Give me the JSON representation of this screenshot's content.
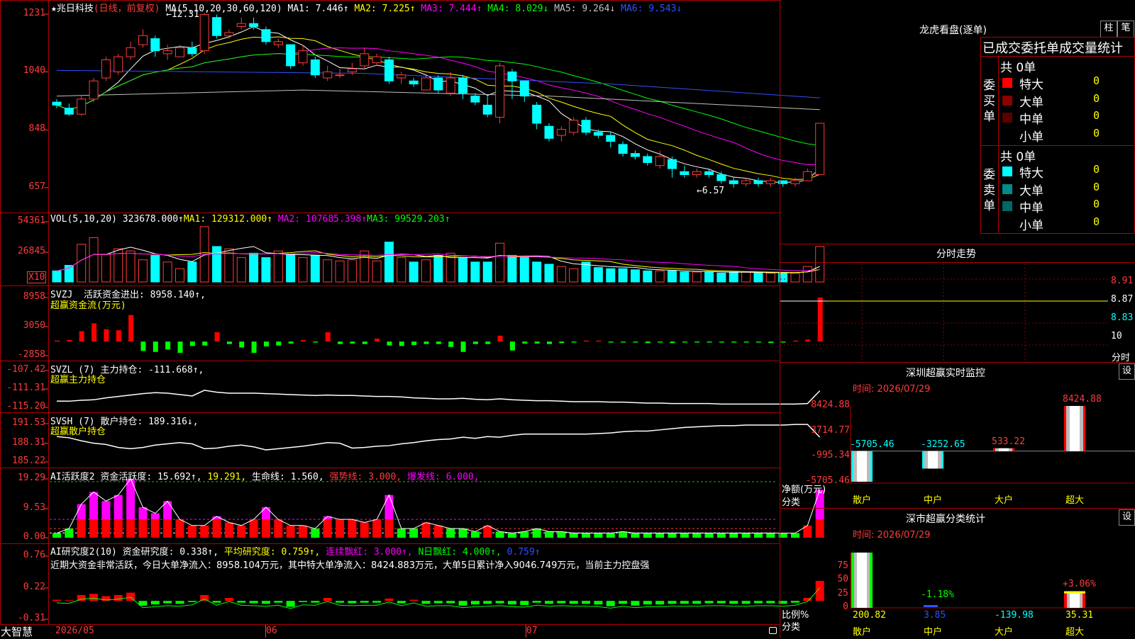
{
  "app": {
    "brand": "大智慧"
  },
  "header": {
    "star": "★",
    "stock": "兆日科技",
    "period": "(日线，前复权)",
    "ma_label": "MA(5,10,20,30,60,120)",
    "ma": [
      {
        "name": "MA1:",
        "value": "7.446↑",
        "color": "#ffffff"
      },
      {
        "name": "MA2:",
        "value": "7.225↑",
        "color": "#ffff00"
      },
      {
        "name": "MA3:",
        "value": "7.444↑",
        "color": "#ff00ff"
      },
      {
        "name": "MA4:",
        "value": "8.029↓",
        "color": "#00ff00"
      },
      {
        "name": "MA5:",
        "value": "9.264↓",
        "color": "#c0c0c0"
      },
      {
        "name": "MA6:",
        "value": "9.543↓",
        "color": "#3050ff"
      }
    ]
  },
  "price_chart": {
    "y_labels": [
      "1231",
      "1040",
      "848",
      "657"
    ],
    "high_marker": "←12.31",
    "low_marker": "←6.57",
    "candles": [
      [
        9.4,
        9.3,
        9.5,
        9.2
      ],
      [
        9.2,
        9.0,
        9.35,
        8.95
      ],
      [
        9.0,
        9.5,
        9.6,
        8.95
      ],
      [
        9.5,
        10.1,
        10.2,
        9.4
      ],
      [
        10.2,
        10.8,
        10.9,
        10.1
      ],
      [
        10.4,
        10.9,
        11.0,
        10.3
      ],
      [
        10.9,
        11.2,
        11.4,
        10.8
      ],
      [
        11.3,
        11.6,
        11.8,
        11.2
      ],
      [
        11.5,
        11.1,
        11.6,
        10.9
      ],
      [
        11.0,
        11.1,
        11.3,
        10.8
      ],
      [
        10.9,
        11.2,
        11.3,
        10.9
      ],
      [
        11.2,
        11.0,
        11.4,
        10.9
      ],
      [
        11.1,
        12.3,
        12.35,
        11.0
      ],
      [
        12.2,
        11.6,
        12.3,
        11.5
      ],
      [
        11.6,
        11.7,
        11.8,
        11.5
      ],
      [
        11.9,
        12.0,
        12.2,
        11.8
      ],
      [
        12.0,
        11.9,
        12.2,
        11.8
      ],
      [
        11.8,
        11.4,
        11.9,
        11.3
      ],
      [
        11.3,
        11.4,
        11.5,
        11.2
      ],
      [
        11.3,
        10.6,
        11.3,
        10.5
      ],
      [
        10.7,
        11.1,
        11.3,
        10.6
      ],
      [
        10.8,
        10.3,
        10.9,
        10.2
      ],
      [
        10.2,
        10.4,
        10.6,
        10.1
      ],
      [
        10.3,
        10.3,
        10.5,
        10.2
      ],
      [
        10.4,
        10.5,
        10.7,
        10.3
      ],
      [
        10.6,
        11.0,
        11.2,
        10.5
      ],
      [
        10.7,
        10.9,
        11.0,
        10.6
      ],
      [
        10.8,
        10.1,
        10.9,
        10.0
      ],
      [
        10.2,
        10.3,
        10.4,
        10.0
      ],
      [
        10.1,
        10.0,
        10.2,
        9.9
      ],
      [
        9.8,
        10.2,
        10.3,
        9.8
      ],
      [
        10.2,
        9.8,
        10.3,
        9.7
      ],
      [
        9.7,
        10.2,
        10.4,
        9.6
      ],
      [
        10.2,
        9.7,
        10.3,
        9.5
      ],
      [
        9.6,
        9.4,
        9.7,
        9.3
      ],
      [
        9.3,
        9.0,
        9.6,
        8.9
      ],
      [
        8.9,
        10.6,
        10.7,
        8.7
      ],
      [
        10.4,
        10.1,
        10.5,
        9.5
      ],
      [
        10.1,
        9.6,
        10.1,
        9.4
      ],
      [
        9.3,
        8.7,
        9.4,
        8.5
      ],
      [
        8.6,
        8.2,
        8.7,
        8.1
      ],
      [
        8.3,
        8.5,
        8.6,
        8.1
      ],
      [
        8.4,
        8.8,
        8.9,
        8.3
      ],
      [
        8.8,
        8.4,
        8.9,
        8.3
      ],
      [
        8.4,
        8.3,
        8.5,
        8.2
      ],
      [
        8.3,
        8.1,
        8.4,
        7.9
      ],
      [
        8.0,
        7.7,
        8.1,
        7.6
      ],
      [
        7.7,
        7.6,
        7.8,
        7.5
      ],
      [
        7.6,
        7.4,
        7.7,
        7.3
      ],
      [
        7.3,
        7.6,
        7.8,
        7.2
      ],
      [
        7.5,
        7.2,
        7.6,
        6.9
      ],
      [
        7.1,
        7.0,
        7.3,
        6.9
      ],
      [
        7.0,
        7.1,
        7.2,
        6.9
      ],
      [
        7.1,
        7.0,
        7.2,
        6.9
      ],
      [
        7.0,
        6.8,
        7.1,
        6.7
      ],
      [
        6.8,
        6.7,
        6.9,
        6.57
      ],
      [
        6.7,
        6.8,
        6.9,
        6.6
      ],
      [
        6.8,
        6.7,
        6.9,
        6.6
      ],
      [
        6.7,
        6.8,
        6.9,
        6.6
      ],
      [
        6.8,
        6.7,
        6.8,
        6.6
      ],
      [
        6.7,
        6.8,
        6.9,
        6.6
      ],
      [
        6.8,
        7.1,
        7.2,
        6.8
      ],
      [
        7.0,
        8.7,
        8.7,
        7.0
      ]
    ]
  },
  "vol": {
    "label": "VOL(5,10,20)",
    "v0": "323678.000↑",
    "ma1": "MA1: 129312.000↑",
    "ma2": "MA2: 107685.398↑",
    "ma3": "MA3: 99529.203↑",
    "y_labels": [
      "54361",
      "26845"
    ],
    "unit": "X10",
    "bars": [
      10,
      15,
      34,
      40,
      25,
      30,
      28,
      20,
      24,
      18,
      12,
      18,
      50,
      32,
      30,
      22,
      26,
      22,
      28,
      25,
      22,
      24,
      20,
      19,
      20,
      28,
      19,
      36,
      22,
      18,
      20,
      24,
      26,
      22,
      18,
      18,
      35,
      24,
      22,
      18,
      16,
      14,
      12,
      18,
      13,
      12,
      12,
      11,
      10,
      10,
      10,
      9,
      9,
      9,
      8,
      9,
      9,
      8,
      8,
      8,
      8,
      14,
      32
    ]
  },
  "svzj": {
    "label": "SVZJ",
    "desc": "活跃资金进出:",
    "value": "8958.140↑,",
    "sub": "超赢资金流(万元)",
    "y_labels": [
      "8958",
      "3050",
      "-2858"
    ],
    "bars": [
      200,
      300,
      2100,
      3700,
      2500,
      2300,
      5400,
      -1900,
      -2100,
      -1600,
      -2300,
      -900,
      -800,
      1900,
      -500,
      -1200,
      -2300,
      -1000,
      -800,
      -400,
      300,
      -200,
      1900,
      -500,
      -400,
      -500,
      600,
      -800,
      -900,
      -700,
      -500,
      -500,
      -1100,
      -2100,
      -500,
      -500,
      1200,
      -1800,
      -400,
      -400,
      -500,
      -300,
      -200,
      200,
      200,
      -200,
      -200,
      -200,
      -300,
      -200,
      -300,
      -200,
      -200,
      -200,
      -200,
      -200,
      -200,
      -200,
      -300,
      -200,
      200,
      400,
      8958
    ]
  },
  "svzl": {
    "label": "SVZL (7)",
    "desc": "主力持仓:",
    "value": "-111.668↑,",
    "sub": "超赢主力持仓",
    "y_labels": [
      "-107.42",
      "-111.31",
      "-115.20"
    ],
    "line": [
      -113.9,
      -113.9,
      -113.7,
      -113.6,
      -113.2,
      -112.9,
      -112.6,
      -112.3,
      -112.1,
      -112.2,
      -112.5,
      -112.8,
      -111.6,
      -112.0,
      -112.2,
      -112.2,
      -112.2,
      -112.3,
      -112.4,
      -112.5,
      -112.6,
      -112.7,
      -112.6,
      -112.7,
      -112.7,
      -112.8,
      -112.9,
      -112.9,
      -113.0,
      -113.2,
      -113.3,
      -113.4,
      -113.4,
      -113.3,
      -113.5,
      -113.6,
      -113.4,
      -113.6,
      -113.7,
      -113.8,
      -113.8,
      -113.9,
      -114.0,
      -114.0,
      -114.0,
      -114.1,
      -114.1,
      -114.2,
      -114.3,
      -114.3,
      -114.4,
      -114.4,
      -114.4,
      -114.4,
      -114.5,
      -114.5,
      -114.5,
      -114.5,
      -114.5,
      -114.5,
      -114.5,
      -114.4,
      -111.7
    ]
  },
  "svsh": {
    "label": "SVSH (7)",
    "desc": "散户持仓:",
    "value": "189.316↓,",
    "sub": "超赢散户持仓",
    "y_labels": [
      "191.53",
      "188.31",
      "185.22"
    ],
    "line": [
      189.4,
      189.2,
      188.7,
      188.3,
      188.1,
      187.6,
      187.4,
      187.6,
      188.0,
      188.2,
      188.4,
      188.2,
      187.4,
      187.5,
      187.8,
      188.0,
      187.7,
      187.2,
      187.4,
      187.6,
      187.8,
      188.1,
      188.4,
      188.3,
      187.5,
      187.6,
      187.8,
      187.9,
      188.2,
      188.4,
      188.7,
      188.9,
      189.0,
      189.3,
      189.1,
      189.4,
      189.3,
      189.6,
      189.8,
      189.8,
      189.8,
      189.8,
      189.8,
      189.8,
      189.9,
      190.0,
      190.2,
      190.3,
      190.3,
      190.5,
      190.7,
      190.9,
      191.0,
      191.1,
      191.2,
      191.2,
      191.3,
      191.3,
      191.3,
      191.3,
      191.4,
      191.4,
      189.3
    ]
  },
  "ai_active": {
    "label": "AI活跃度2",
    "desc": "资金活跃度:",
    "v1": "15.692↑,",
    "v2": "19.291,",
    "life": "生命线: 1.560,",
    "strong": "强势线: 3.000,",
    "burst": "爆发线: 6.000,",
    "y_labels": [
      "19.29",
      "9.53",
      "0.00"
    ],
    "bars": [
      1.5,
      3,
      11,
      15,
      12,
      14,
      19.3,
      10,
      8,
      12,
      6,
      4,
      4,
      7,
      5,
      4,
      6,
      10,
      6,
      4,
      4,
      3,
      7,
      6,
      6,
      5,
      6,
      14,
      3,
      3,
      5,
      4,
      3,
      3,
      2,
      4,
      2,
      1.5,
      2,
      3,
      2,
      2,
      1.5,
      1.5,
      1.5,
      1.5,
      2,
      1.5,
      1.5,
      1.5,
      1.5,
      1.5,
      1.5,
      1.5,
      1.5,
      1.5,
      1.5,
      1.5,
      1.5,
      1.5,
      1.5,
      4,
      15.7
    ]
  },
  "ai_research": {
    "label": "AI研究度2(10)",
    "desc": "资金研究度:",
    "v1": "0.338↑,",
    "avg": "平均研究度: 0.759↑,",
    "cont": "连续飘红: 3.000↑,",
    "nday": "N日飘红: 4.000↑,",
    "v2": "0.759↑",
    "note": "近期大资金非常活跃，今日大单净流入：8958.104万元，其中特大单净流入：8424.883万元，大单5日累计净入9046.749万元，当前主力控盘强",
    "y_labels": [
      "0.76",
      "0.22",
      "-0.31"
    ],
    "bars": [
      0.02,
      0.01,
      0.1,
      0.12,
      0.08,
      0.1,
      0.14,
      -0.08,
      -0.06,
      -0.04,
      -0.05,
      -0.02,
      0.1,
      -0.03,
      0.05,
      -0.03,
      -0.04,
      -0.05,
      -0.03,
      -0.1,
      -0.02,
      -0.03,
      0.05,
      -0.03,
      -0.04,
      -0.03,
      -0.03,
      0.04,
      -0.04,
      0.02,
      -0.05,
      -0.04,
      -0.04,
      -0.08,
      -0.06,
      -0.05,
      -0.04,
      -0.06,
      -0.07,
      -0.03,
      -0.05,
      -0.04,
      -0.05,
      -0.05,
      -0.06,
      -0.09,
      -0.05,
      -0.08,
      -0.06,
      -0.06,
      -0.05,
      -0.05,
      -0.05,
      -0.04,
      -0.04,
      -0.05,
      -0.05,
      -0.04,
      -0.04,
      -0.05,
      -0.03,
      0.05,
      0.34
    ]
  },
  "x_axis": [
    "2026/05",
    "06",
    "07"
  ],
  "right": {
    "dragon_title": "龙虎看盘(逐单)",
    "btn_zhu": "柱",
    "btn_bi": "笔",
    "stat_title": "已成交委托单成交量统计",
    "buy_label": "委买单",
    "sell_label": "委卖单",
    "buy_total": "共 0单",
    "sell_total": "共 0单",
    "buy_rows": [
      {
        "name": "特大",
        "val": "0",
        "color": "#ff0000"
      },
      {
        "name": "大单",
        "val": "0",
        "color": "#8b0000"
      },
      {
        "name": "中单",
        "val": "0",
        "color": "#5a0000"
      },
      {
        "name": "小单",
        "val": "0",
        "color": ""
      }
    ],
    "sell_rows": [
      {
        "name": "特大",
        "val": "0",
        "color": "#00ffff"
      },
      {
        "name": "大单",
        "val": "0",
        "color": "#008b8b"
      },
      {
        "name": "中单",
        "val": "0",
        "color": "#006666"
      },
      {
        "name": "小单",
        "val": "0",
        "color": ""
      }
    ],
    "fenshi_title": "分时走势",
    "fenshi_y": [
      "8.91",
      "8.87",
      "8.83",
      "10"
    ],
    "fenshi_unit": "分时",
    "sz_title": "深圳超赢实时监控",
    "sz_time": "时间: 2026/07/29",
    "sz_y": [
      "8424.88",
      "3714.77",
      "-995.34",
      "-5705.46"
    ],
    "sz_bars": [
      {
        "cat": "散户",
        "val": -5705.46,
        "label": "-5705.46"
      },
      {
        "cat": "中户",
        "val": -3252.65,
        "label": "-3252.65"
      },
      {
        "cat": "大户",
        "val": 533.22,
        "label": "533.22"
      },
      {
        "cat": "超大",
        "val": 8424.88,
        "label": "8424.88"
      }
    ],
    "sz_axis_title": "净额(万元)",
    "sz_axis_sub": "分类",
    "cls_title": "深市超赢分类统计",
    "cls_time": "时间: 2026/07/29",
    "cls_y": [
      "75",
      "50",
      "25",
      "0"
    ],
    "cls_bars": [
      {
        "cat": "散户",
        "pct": 200.82,
        "label": "",
        "bottom": "200.82"
      },
      {
        "cat": "中户",
        "pct": -1.18,
        "label": "-1.18%",
        "bottom": "3.85"
      },
      {
        "cat": "大户",
        "pct": 0,
        "label": "",
        "bottom": "-139.98"
      },
      {
        "cat": "超大",
        "pct": 30,
        "label": "+3.06%",
        "bottom": "35.31"
      }
    ],
    "cls_axis_title": "比例%",
    "cls_axis_sub": "分类",
    "set": "设"
  }
}
